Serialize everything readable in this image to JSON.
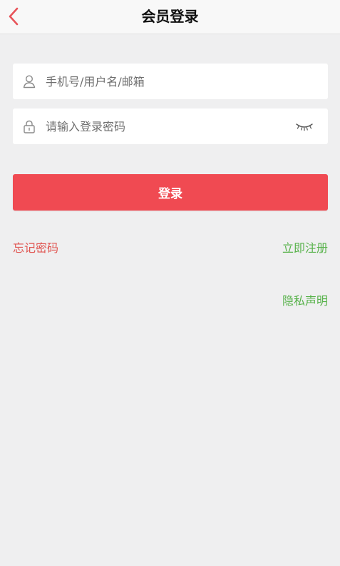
{
  "header": {
    "title": "会员登录",
    "back_icon": "chevron-left-icon"
  },
  "form": {
    "username": {
      "placeholder": "手机号/用户名/邮箱",
      "value": "",
      "icon": "user-icon"
    },
    "password": {
      "placeholder": "请输入登录密码",
      "value": "",
      "icon": "lock-icon",
      "toggle_icon": "eye-closed-icon"
    },
    "login_label": "登录"
  },
  "links": {
    "forgot_password": "忘记密码",
    "register": "立即注册",
    "privacy": "隐私声明"
  },
  "colors": {
    "accent": "#f04a52",
    "back_arrow": "#e8545a",
    "forgot_link": "#e0534f",
    "green_link": "#57b24a",
    "background": "#efeff0"
  }
}
